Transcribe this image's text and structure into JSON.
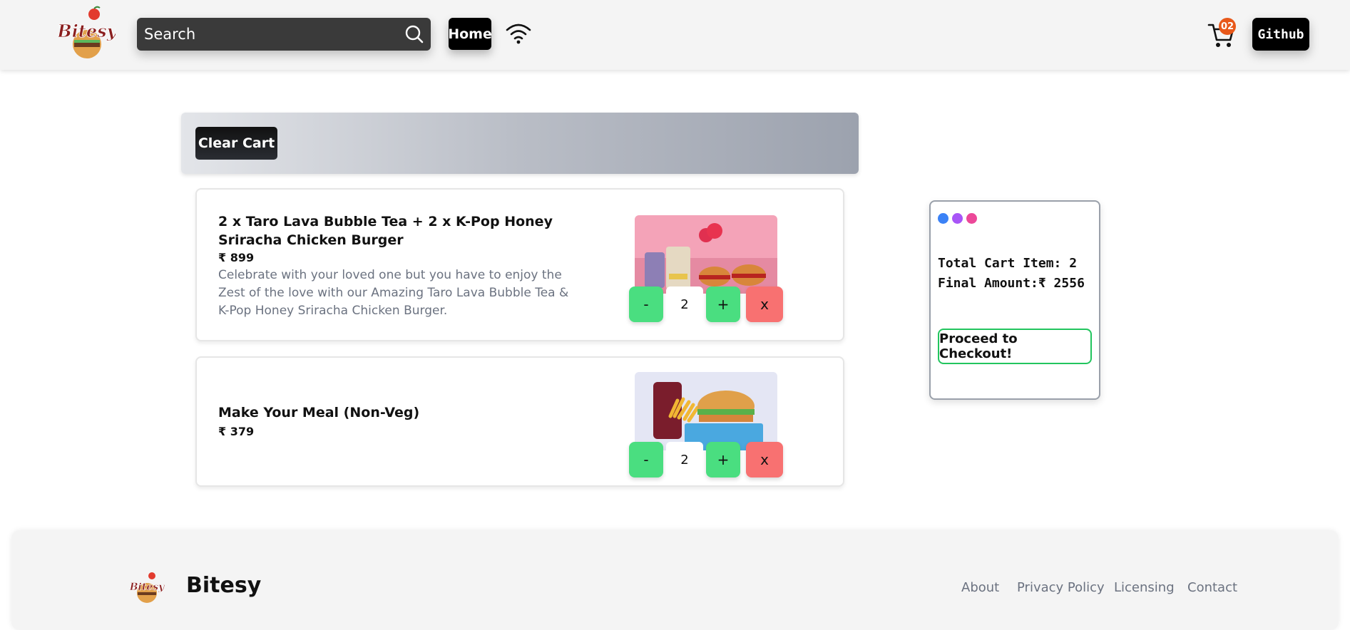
{
  "header": {
    "logo_text": "Bitesy",
    "search_placeholder": "Search",
    "home_label": "Home",
    "cart_count": "02",
    "github_label": "Github"
  },
  "cart_actions": {
    "clear_label": "Clear Cart"
  },
  "items": [
    {
      "title": "2 x Taro Lava Bubble Tea + 2 x K-Pop Honey Sriracha Chicken Burger",
      "price": "₹ 899",
      "description": "Celebrate with your loved one but you have to enjoy the Zest of the love with our Amazing Taro Lava Bubble Tea & K-Pop Honey Sriracha Chicken Burger.",
      "quantity": "2",
      "minus_label": "-",
      "plus_label": "+",
      "remove_label": "x"
    },
    {
      "title": "Make Your Meal (Non-Veg)",
      "price": "₹ 379",
      "quantity": "2",
      "minus_label": "-",
      "plus_label": "+",
      "remove_label": "x"
    }
  ],
  "summary": {
    "total_items_line": "Total Cart Item: 2",
    "final_amount_line": "Final Amount:₹ 2556",
    "checkout_label": "Proceed to Checkout!",
    "dot_colors": [
      "#3b82f6",
      "#a855f7",
      "#ec4899"
    ]
  },
  "footer": {
    "brand": "Bitesy",
    "links": [
      "About",
      "Privacy Policy",
      "Licensing",
      "Contact"
    ]
  }
}
